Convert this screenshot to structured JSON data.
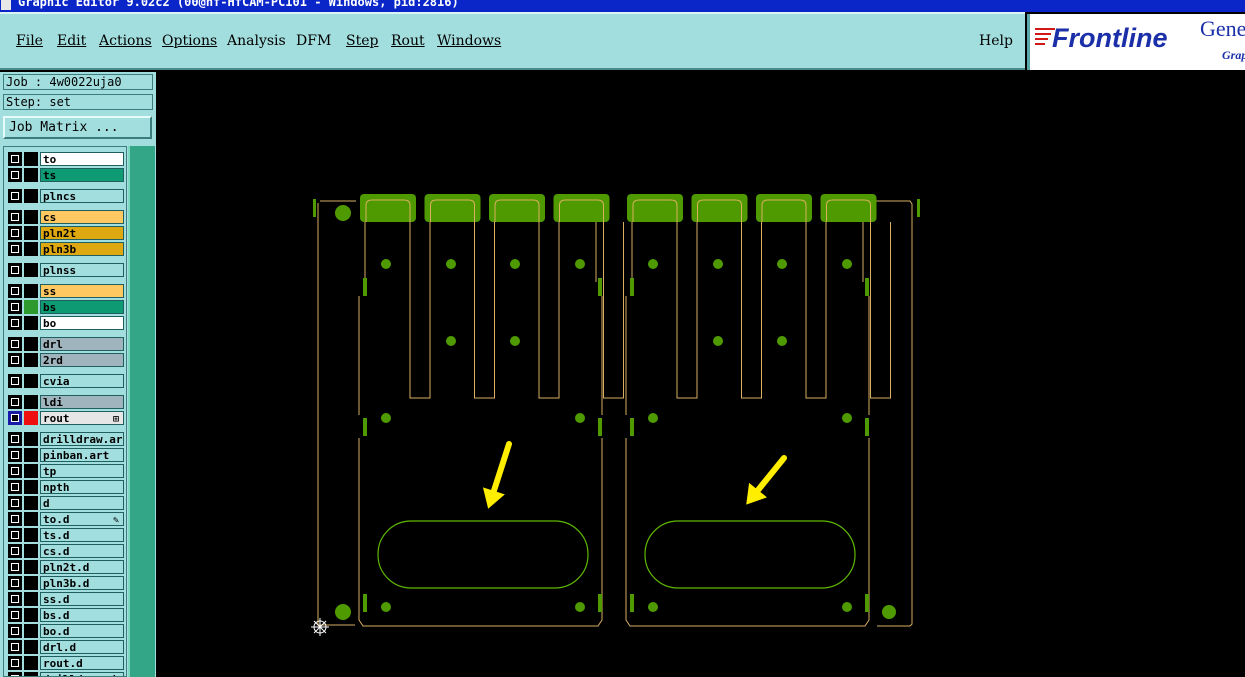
{
  "title_bar": {
    "text": "Graphic Editor 9.02c2 (00@hf-HfCAM-PC101 - Windows, pid:2816)"
  },
  "menu": {
    "items": [
      "File",
      "Edit",
      "Actions",
      "Options",
      "Analysis",
      "DFM",
      "Step",
      "Rout",
      "Windows"
    ],
    "help": "Help"
  },
  "logo": {
    "brand": "Frontline",
    "product": "Gene",
    "subtitle": "Grap"
  },
  "job": {
    "job_line": "Job : 4w0022uja0",
    "step_line": "Step: set",
    "job_matrix_button": "Job Matrix ..."
  },
  "layers": [
    {
      "name": "to",
      "color": "#ffffff",
      "swatch": "#000000"
    },
    {
      "name": "ts",
      "color": "#0e9a72",
      "swatch": "#000000"
    },
    {
      "name": "plncs",
      "color": "#a3dede",
      "swatch": "#000000"
    },
    {
      "name": "cs",
      "color": "#ffc860",
      "swatch": "#000000"
    },
    {
      "name": "pln2t",
      "color": "#e0a810",
      "swatch": "#000000"
    },
    {
      "name": "pln3b",
      "color": "#e0a810",
      "swatch": "#000000"
    },
    {
      "name": "plnss",
      "color": "#a3dede",
      "swatch": "#000000"
    },
    {
      "name": "ss",
      "color": "#ffc860",
      "swatch": "#000000"
    },
    {
      "name": "bs",
      "color": "#0e9a72",
      "swatch": "#2e9a2e"
    },
    {
      "name": "bo",
      "color": "#ffffff",
      "swatch": "#000000"
    },
    {
      "name": "drl",
      "color": "#9fb4bc",
      "swatch": "#000000"
    },
    {
      "name": "2rd",
      "color": "#9fb4bc",
      "swatch": "#000000"
    },
    {
      "name": "cvia",
      "color": "#a3dede",
      "swatch": "#000000"
    },
    {
      "name": "ldi",
      "color": "#9fb4bc",
      "swatch": "#000000"
    },
    {
      "name": "rout",
      "color": "#e6e6e6",
      "swatch": "#ee1010",
      "mark": "⊞"
    },
    {
      "name": "drilldraw.ar",
      "color": "#a3dede",
      "swatch": "#000000"
    },
    {
      "name": "pinban.art",
      "color": "#a3dede",
      "swatch": "#000000"
    },
    {
      "name": "tp",
      "color": "#a3dede",
      "swatch": "#000000"
    },
    {
      "name": "npth",
      "color": "#a3dede",
      "swatch": "#000000"
    },
    {
      "name": "d",
      "color": "#a3dede",
      "swatch": "#000000"
    },
    {
      "name": "to.d",
      "color": "#a3dede",
      "swatch": "#000000",
      "mark": "✎"
    },
    {
      "name": "ts.d",
      "color": "#a3dede",
      "swatch": "#000000"
    },
    {
      "name": "cs.d",
      "color": "#a3dede",
      "swatch": "#000000"
    },
    {
      "name": "pln2t.d",
      "color": "#a3dede",
      "swatch": "#000000"
    },
    {
      "name": "pln3b.d",
      "color": "#a3dede",
      "swatch": "#000000"
    },
    {
      "name": "ss.d",
      "color": "#a3dede",
      "swatch": "#000000"
    },
    {
      "name": "bs.d",
      "color": "#a3dede",
      "swatch": "#000000"
    },
    {
      "name": "bo.d",
      "color": "#a3dede",
      "swatch": "#000000"
    },
    {
      "name": "drl.d",
      "color": "#a3dede",
      "swatch": "#000000"
    },
    {
      "name": "rout.d",
      "color": "#a3dede",
      "swatch": "#000000"
    },
    {
      "name": "drilldraw.d",
      "color": "#a3dede",
      "swatch": "#000000"
    }
  ],
  "colors": {
    "panel": "#a3dede",
    "outline": "#d8b060",
    "feature": "#4f9a00",
    "arrow": "#ffee00",
    "slot": "#5fb800"
  },
  "icons": {
    "origin": "origin-crosshair-icon",
    "annotation": "arrow-icon"
  }
}
